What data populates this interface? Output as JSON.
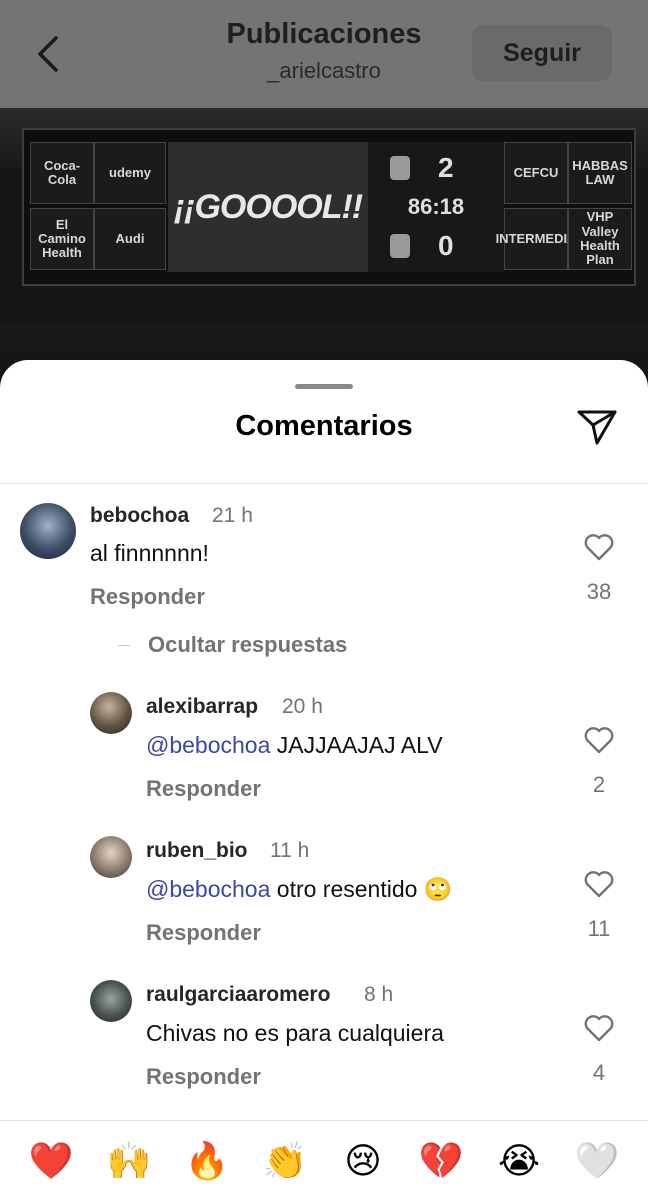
{
  "header": {
    "title": "Publicaciones",
    "username": "_arielcastro",
    "follow_label": "Seguir"
  },
  "post_image": {
    "ads_left": [
      "Coca-Cola",
      "udemy",
      "El Camino Health",
      "Audi"
    ],
    "goal_text": "¡¡GOOOOL!!",
    "home_score": "2",
    "clock": "86:18",
    "away_score": "0",
    "ads_right": [
      "CEFCU",
      "HABBAS LAW",
      "INTERMEDIA",
      "VHP Valley Health Plan"
    ]
  },
  "sheet": {
    "title": "Comentarios",
    "hide_replies": "Ocultar respuestas"
  },
  "comments": [
    {
      "username": "bebochoa",
      "time": "21 h",
      "text": "al finnnnnn!",
      "reply_label": "Responder",
      "likes": "38"
    },
    {
      "username": "alexibarrap",
      "time": "20 h",
      "mention": "@bebochoa",
      "text": " JAJJAAJAJ ALV",
      "reply_label": "Responder",
      "likes": "2"
    },
    {
      "username": "ruben_bio",
      "time": "11 h",
      "mention": "@bebochoa",
      "text": " otro resentido 🙄",
      "reply_label": "Responder",
      "likes": "11"
    },
    {
      "username": "raulgarciaaromero",
      "time": "8 h",
      "text": "Chivas no es para cualquiera",
      "reply_label": "Responder",
      "likes": "4"
    }
  ],
  "emoji_bar": [
    "❤️",
    "🙌",
    "🔥",
    "👏",
    "😢",
    "💔",
    "😭",
    "🤍"
  ],
  "colors": {
    "mention": "#3b46a8",
    "secondary_text": "#737373",
    "overlay": "#747474"
  }
}
